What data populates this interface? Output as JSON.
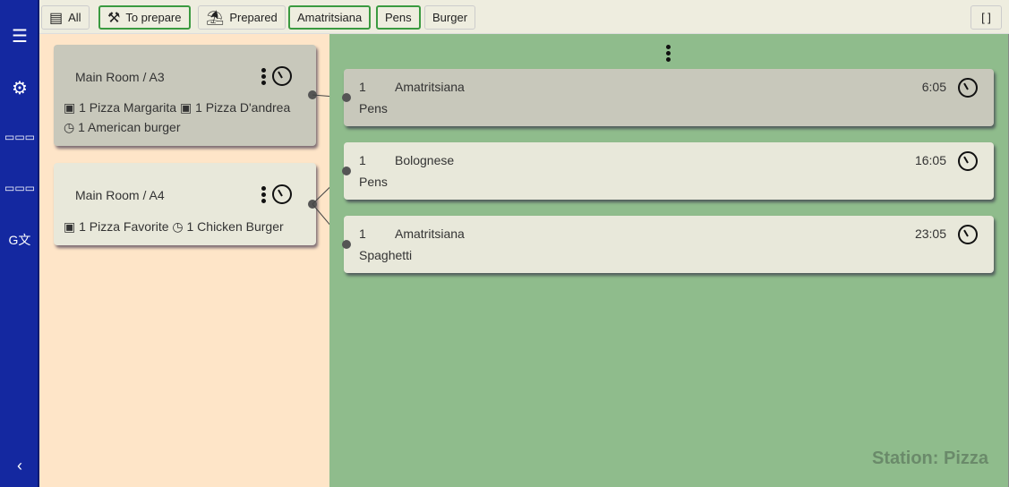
{
  "filters": [
    {
      "label": "All",
      "icon": "list-icon"
    },
    {
      "label": "To prepare",
      "icon": "mixer-icon"
    },
    {
      "label": "Prepared",
      "icon": "prepared-icon"
    },
    {
      "label": "Amatritsiana"
    },
    {
      "label": "Pens"
    },
    {
      "label": "Burger"
    }
  ],
  "tables": [
    {
      "title": "Main Room / A3",
      "line1": "1 Pizza Margarita",
      "line2": "1 Pizza D'andrea",
      "line3": "1 American burger"
    },
    {
      "title": "Main Room / A4",
      "line1": "1 Pizza Favorite",
      "line2": "1 Chicken Burger"
    }
  ],
  "orders": [
    {
      "qty": "1",
      "name": "Amatritsiana",
      "time": "6:05",
      "sub": "Pens"
    },
    {
      "qty": "1",
      "name": "Bolognese",
      "time": "16:05",
      "sub": "Pens"
    },
    {
      "qty": "1",
      "name": "Amatritsiana",
      "time": "23:05",
      "sub": "Spaghetti"
    }
  ],
  "station": "Station: Pizza",
  "colors": {
    "sidebar": "#1428a0",
    "left": "#fee5c8",
    "right": "#8fbc8c",
    "active": "#3a9a40"
  }
}
